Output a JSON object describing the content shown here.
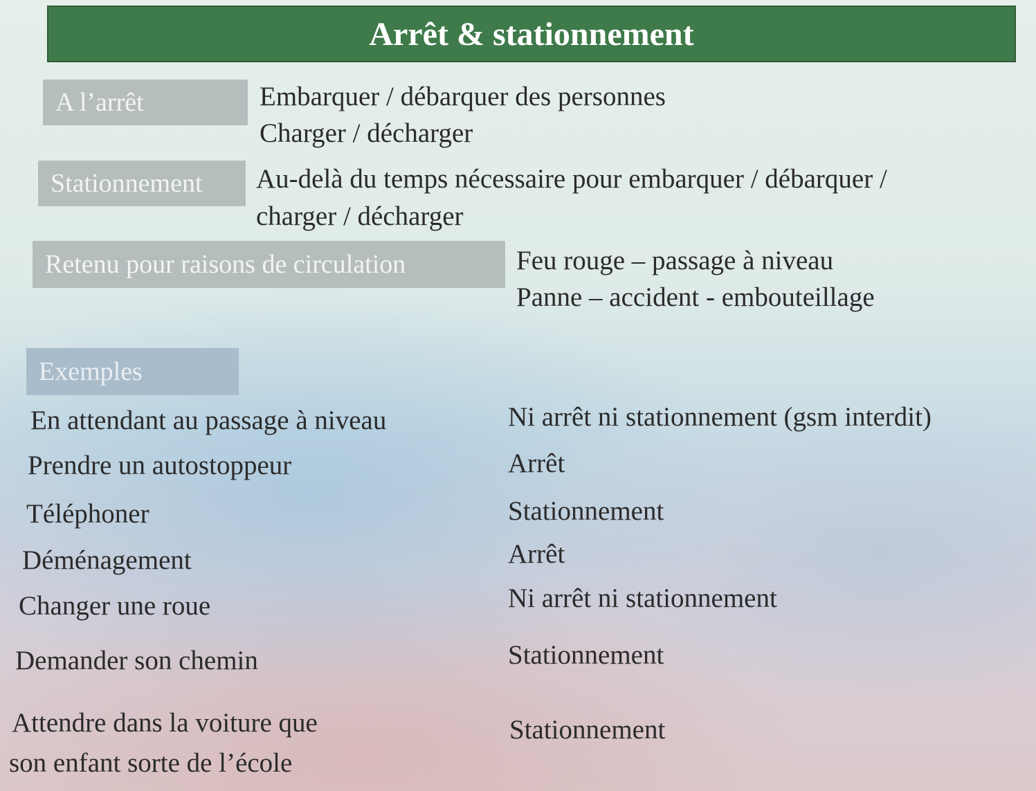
{
  "title": "Arrêt & stationnement",
  "definitions": [
    {
      "label": "A l’arrêt",
      "lines": [
        "Embarquer / débarquer des personnes",
        "Charger / décharger"
      ]
    },
    {
      "label": "Stationnement",
      "lines": [
        "Au-delà du temps nécessaire pour embarquer / débarquer /",
        "charger / décharger"
      ]
    },
    {
      "label": "Retenu pour raisons de circulation",
      "lines": [
        "Feu rouge – passage à niveau",
        "Panne – accident - embouteillage"
      ]
    }
  ],
  "examples_header": "Exemples",
  "examples": [
    {
      "situation": [
        "En attendant au passage à niveau"
      ],
      "answer": "Ni arrêt ni stationnement (gsm interdit)"
    },
    {
      "situation": [
        "Prendre un autostoppeur"
      ],
      "answer": "Arrêt"
    },
    {
      "situation": [
        "Téléphoner"
      ],
      "answer": "Stationnement"
    },
    {
      "situation": [
        "Déménagement"
      ],
      "answer": "Arrêt"
    },
    {
      "situation": [
        "Changer une roue"
      ],
      "answer": "Ni arrêt ni stationnement"
    },
    {
      "situation": [
        "Demander son chemin"
      ],
      "answer": "Stationnement"
    },
    {
      "situation": [
        "Attendre dans la voiture que",
        "son enfant sorte de l’école"
      ],
      "answer": "Stationnement"
    }
  ],
  "colors": {
    "title_bar": "#3f7a4b",
    "label_box": "#b5bdbd",
    "examples_box": "#a9bccb"
  }
}
